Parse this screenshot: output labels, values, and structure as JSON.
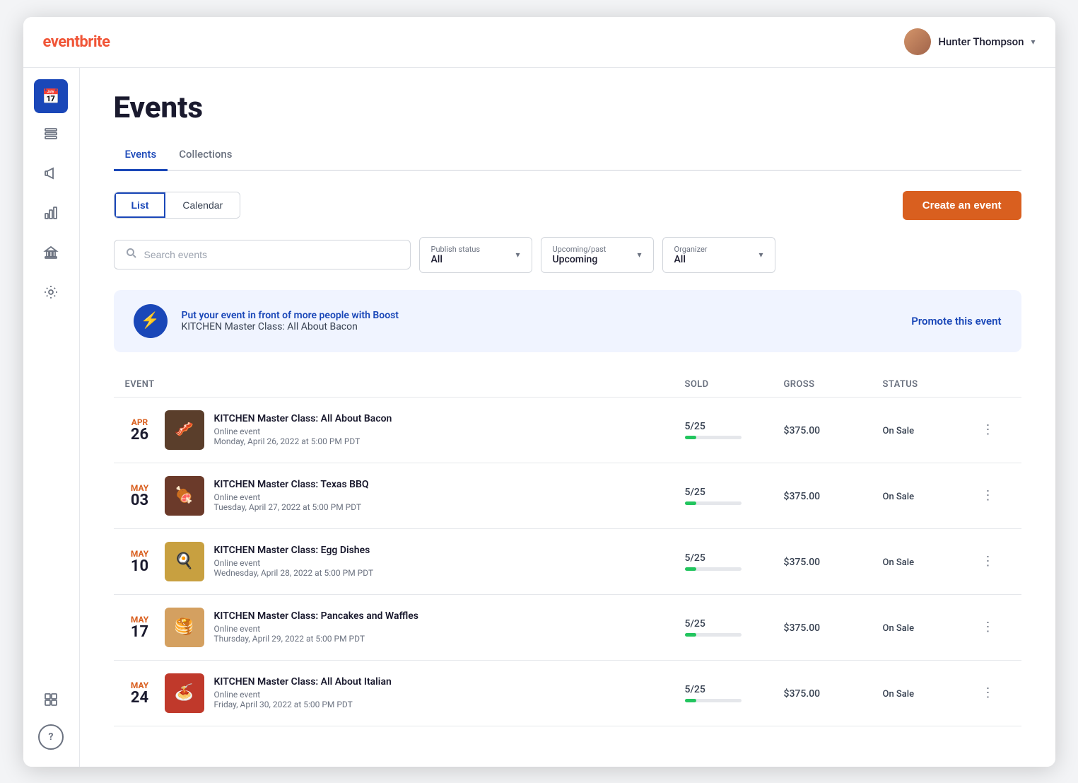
{
  "app": {
    "name": "eventbrite"
  },
  "topbar": {
    "user_name": "Hunter Thompson",
    "chevron": "▾"
  },
  "sidebar": {
    "items": [
      {
        "id": "calendar",
        "icon": "📅",
        "active": true,
        "label": "Calendar"
      },
      {
        "id": "list",
        "icon": "☰",
        "active": false,
        "label": "List"
      },
      {
        "id": "megaphone",
        "icon": "📢",
        "active": false,
        "label": "Marketing"
      },
      {
        "id": "chart",
        "icon": "📊",
        "active": false,
        "label": "Analytics"
      },
      {
        "id": "bank",
        "icon": "🏦",
        "active": false,
        "label": "Finance"
      },
      {
        "id": "settings",
        "icon": "⚙",
        "active": false,
        "label": "Settings"
      }
    ],
    "bottom": [
      {
        "id": "grid",
        "icon": "⊞",
        "label": "Apps"
      },
      {
        "id": "help",
        "icon": "?",
        "label": "Help"
      }
    ]
  },
  "page": {
    "title": "Events",
    "tabs": [
      {
        "id": "events",
        "label": "Events",
        "active": true
      },
      {
        "id": "collections",
        "label": "Collections",
        "active": false
      }
    ]
  },
  "toolbar": {
    "view_list_label": "List",
    "view_calendar_label": "Calendar",
    "create_button_label": "Create an event"
  },
  "filters": {
    "search_placeholder": "Search events",
    "publish_status": {
      "label": "Publish status",
      "value": "All"
    },
    "time_filter": {
      "label": "Upcoming/past",
      "value": "Upcoming"
    },
    "organizer": {
      "label": "Organizer",
      "value": "All"
    }
  },
  "promo_banner": {
    "icon": "⚡",
    "title": "Put your event in front of more people with Boost",
    "subtitle": "KITCHEN Master Class: All About Bacon",
    "link": "Promote this event"
  },
  "table": {
    "headers": [
      "Event",
      "Sold",
      "Gross",
      "Status"
    ],
    "rows": [
      {
        "month": "APR",
        "day": "26",
        "title": "KITCHEN Master Class: All About Bacon",
        "type": "Online event",
        "date_time": "Monday, April 26, 2022 at 5:00 PM PDT",
        "sold": "5/25",
        "sold_num": 5,
        "sold_max": 25,
        "gross": "$375.00",
        "status": "On Sale",
        "thumb_color": "#5a3e2b",
        "thumb_emoji": "🥓"
      },
      {
        "month": "MAY",
        "day": "03",
        "title": "KITCHEN Master Class: Texas BBQ",
        "type": "Online event",
        "date_time": "Tuesday, April 27, 2022 at 5:00 PM PDT",
        "sold": "5/25",
        "sold_num": 5,
        "sold_max": 25,
        "gross": "$375.00",
        "status": "On Sale",
        "thumb_color": "#6b3a2a",
        "thumb_emoji": "🍖"
      },
      {
        "month": "MAY",
        "day": "10",
        "title": "KITCHEN Master Class: Egg Dishes",
        "type": "Online event",
        "date_time": "Wednesday, April 28, 2022 at 5:00 PM PDT",
        "sold": "5/25",
        "sold_num": 5,
        "sold_max": 25,
        "gross": "$375.00",
        "status": "On Sale",
        "thumb_color": "#c8a040",
        "thumb_emoji": "🍳"
      },
      {
        "month": "MAY",
        "day": "17",
        "title": "KITCHEN Master Class: Pancakes and Waffles",
        "type": "Online event",
        "date_time": "Thursday, April 29, 2022 at 5:00 PM PDT",
        "sold": "5/25",
        "sold_num": 5,
        "sold_max": 25,
        "gross": "$375.00",
        "status": "On Sale",
        "thumb_color": "#d4a060",
        "thumb_emoji": "🥞"
      },
      {
        "month": "MAY",
        "day": "24",
        "title": "KITCHEN Master Class: All About Italian",
        "type": "Online event",
        "date_time": "Friday, April 30, 2022 at 5:00 PM PDT",
        "sold": "5/25",
        "sold_num": 5,
        "sold_max": 25,
        "gross": "$375.00",
        "status": "On Sale",
        "thumb_color": "#c0392b",
        "thumb_emoji": "🍝"
      }
    ]
  },
  "colors": {
    "accent": "#d95f1f",
    "brand_blue": "#1a47b8",
    "success": "#22c55e"
  }
}
